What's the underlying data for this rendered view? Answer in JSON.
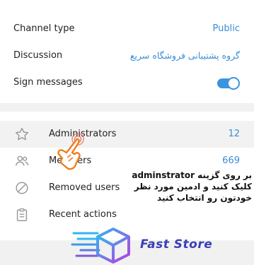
{
  "settings": {
    "channel_type_label": "Channel type",
    "channel_type_value": "Public",
    "discussion_label": "Discussion",
    "discussion_value": "گروه پشتیبانی فروشگاه سریع",
    "sign_messages_label": "Sign messages",
    "sign_messages_enabled": true
  },
  "members_menu": {
    "administrators_label": "Administrators",
    "administrators_count": "12",
    "members_label": "Members",
    "members_count": "669",
    "removed_users_label": "Removed users",
    "recent_actions_label": "Recent actions"
  },
  "annotation": {
    "line1": "بر روی گزینه adminstrator",
    "line2": "کلیک کنید و ادمین مورد نظر",
    "line3": "خودتون رو انتخاب کنید"
  },
  "watermark": {
    "brand": "Fast Store"
  },
  "colors": {
    "accent": "#3a8dd5",
    "toggle": "#3b95de",
    "brand": "#3b3fb6"
  }
}
